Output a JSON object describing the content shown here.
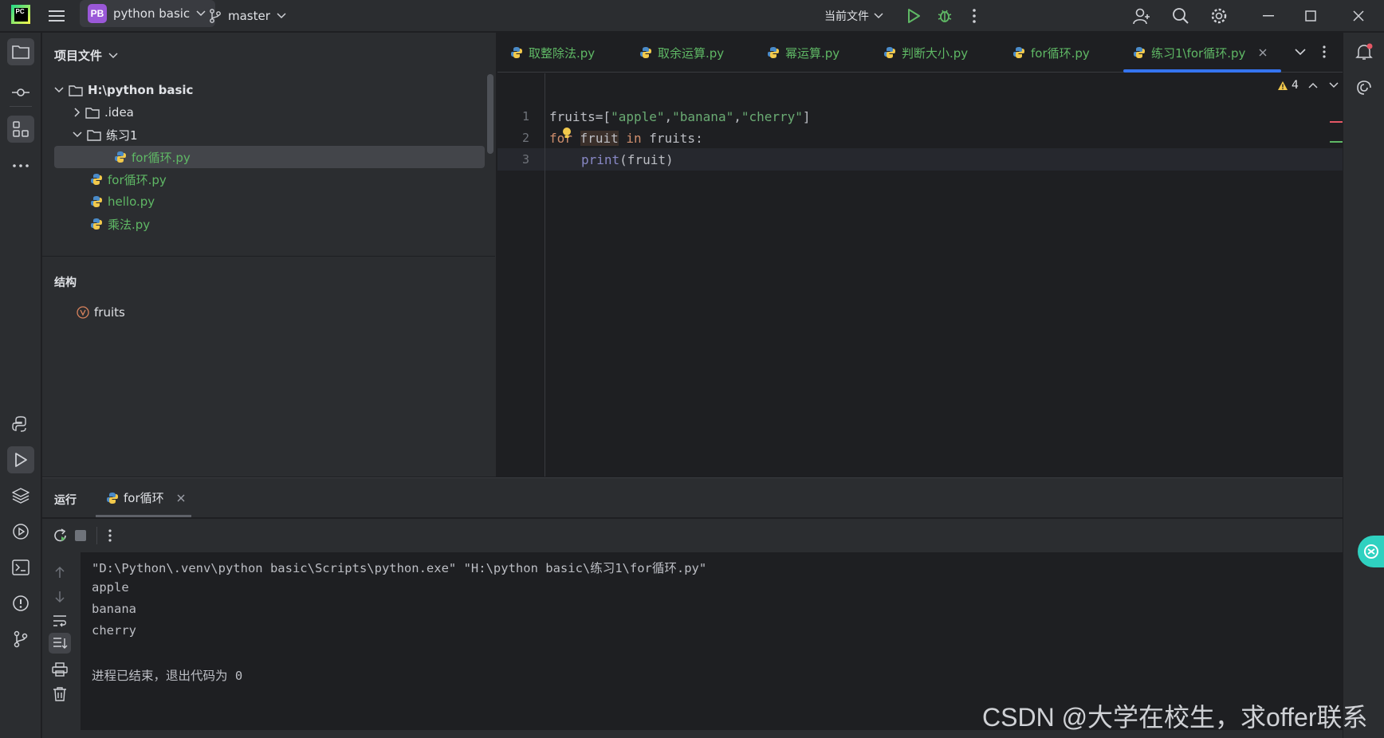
{
  "titlebar": {
    "project_badge": "PB",
    "project_name": "python basic",
    "branch": "master",
    "run_config": "当前文件"
  },
  "project_panel": {
    "title": "项目文件",
    "tree": [
      {
        "label": "H:\\python basic",
        "kind": "folder-root"
      },
      {
        "label": ".idea",
        "kind": "folder"
      },
      {
        "label": "练习1",
        "kind": "folder"
      },
      {
        "label": "for循环.py",
        "kind": "py"
      },
      {
        "label": "for循环.py",
        "kind": "py"
      },
      {
        "label": "hello.py",
        "kind": "py"
      },
      {
        "label": "乘法.py",
        "kind": "py"
      }
    ],
    "structure_title": "结构",
    "structure_items": [
      "fruits"
    ]
  },
  "editor": {
    "tabs": [
      "取整除法.py",
      "取余运算.py",
      "幂运算.py",
      "判断大小.py",
      "for循环.py",
      "练习1\\for循环.py"
    ],
    "active_tab_index": 5,
    "warnings_count": "4",
    "line_numbers": [
      "1",
      "2",
      "3"
    ],
    "code": {
      "l1_a": "fruits",
      "l1_b": "=[",
      "l1_s1": "\"apple\"",
      "l1_c1": ",",
      "l1_s2": "\"banana\"",
      "l1_c2": ",",
      "l1_s3": "\"cherry\"",
      "l1_end": "]",
      "l2_for": "for",
      "l2_var": "fruit",
      "l2_in": "in",
      "l2_rest": "fruits:",
      "l3_print": "print",
      "l3_rest": "(fruit)"
    }
  },
  "run_panel": {
    "label": "运行",
    "tab": "for循环",
    "output": [
      "\"D:\\Python\\.venv\\python basic\\Scripts\\python.exe\" \"H:\\python basic\\练习1\\for循环.py\"",
      "apple",
      "banana",
      "cherry",
      "",
      "进程已结束，退出代码为 0"
    ]
  },
  "watermark": "CSDN @大学在校生，求offer联系",
  "colors": {
    "accent": "#3574f0",
    "python_file": "#5fb865",
    "keyword": "#cf8e6d",
    "string": "#6aab73",
    "builtin": "#8888c6"
  }
}
